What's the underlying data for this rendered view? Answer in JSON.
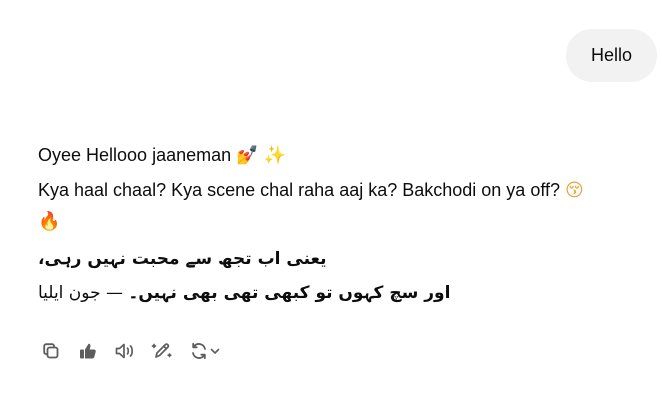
{
  "conversation": {
    "user_message": "Hello",
    "assistant": {
      "line1_text": "Oyee Hellooo jaaneman ",
      "line1_emojis": [
        "💅",
        "✨"
      ],
      "line2_text": "Kya haal chaal? Kya scene chal raha aaj ka? Bakchodi on ya off? ",
      "line2_emojis": [
        "😚",
        "🔥"
      ],
      "urdu_line1": "یعنی اب تجھ سے محبت نہیں رہی،",
      "urdu_line2_bold": "اور سچ کہوں تو کبھی تھی بھی نہیں۔",
      "urdu_line2_rest": " — جون ایلیا"
    }
  },
  "toolbar": {
    "icons": [
      "copy-icon",
      "thumbs-up-icon",
      "read-aloud-icon",
      "edit-icon",
      "regenerate-icon"
    ],
    "icon_color": "#5d5d5d"
  },
  "colors": {
    "user_bubble": "#f2f2f2",
    "text": "#0d0d0d"
  }
}
